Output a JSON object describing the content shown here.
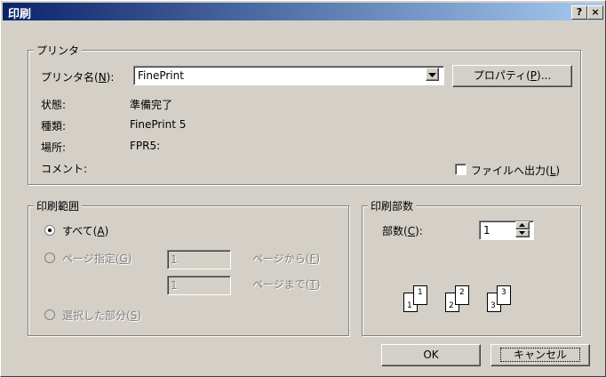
{
  "window": {
    "title": "印刷",
    "help_label": "?",
    "close_label": "×"
  },
  "printer": {
    "group_label": "プリンタ",
    "name_label_pre": "プリンタ名(",
    "name_label_key": "N",
    "name_label_post": "):",
    "name_value": "FinePrint",
    "properties_pre": "プロパティ(",
    "properties_key": "P",
    "properties_post": ")...",
    "status_label": "状態:",
    "status_value": "準備完了",
    "type_label": "種類:",
    "type_value": "FinePrint 5",
    "location_label": "場所:",
    "location_value": "FPR5:",
    "comment_label": "コメント:",
    "print_to_file_pre": "ファイルへ出力(",
    "print_to_file_key": "L",
    "print_to_file_post": ")",
    "print_to_file_checked": false
  },
  "range": {
    "group_label": "印刷範囲",
    "all_pre": "すべて(",
    "all_key": "A",
    "all_post": ")",
    "pages_pre": "ページ指定(",
    "pages_key": "G",
    "pages_post": ")",
    "from_value": "1",
    "from_label_pre": "ページから(",
    "from_label_key": "F",
    "from_label_post": ")",
    "to_value": "1",
    "to_label_pre": "ページまで(",
    "to_label_key": "T",
    "to_label_post": ")",
    "selection_pre": "選択した部分(",
    "selection_key": "S",
    "selection_post": ")",
    "selected": "all"
  },
  "copies": {
    "group_label": "印刷部数",
    "count_label_pre": "部数(",
    "count_label_key": "C",
    "count_label_post": "):",
    "count_value": "1",
    "collate_pages": [
      "1",
      "1",
      "2",
      "2",
      "3",
      "3"
    ]
  },
  "buttons": {
    "ok": "OK",
    "cancel": "キャンセル"
  }
}
